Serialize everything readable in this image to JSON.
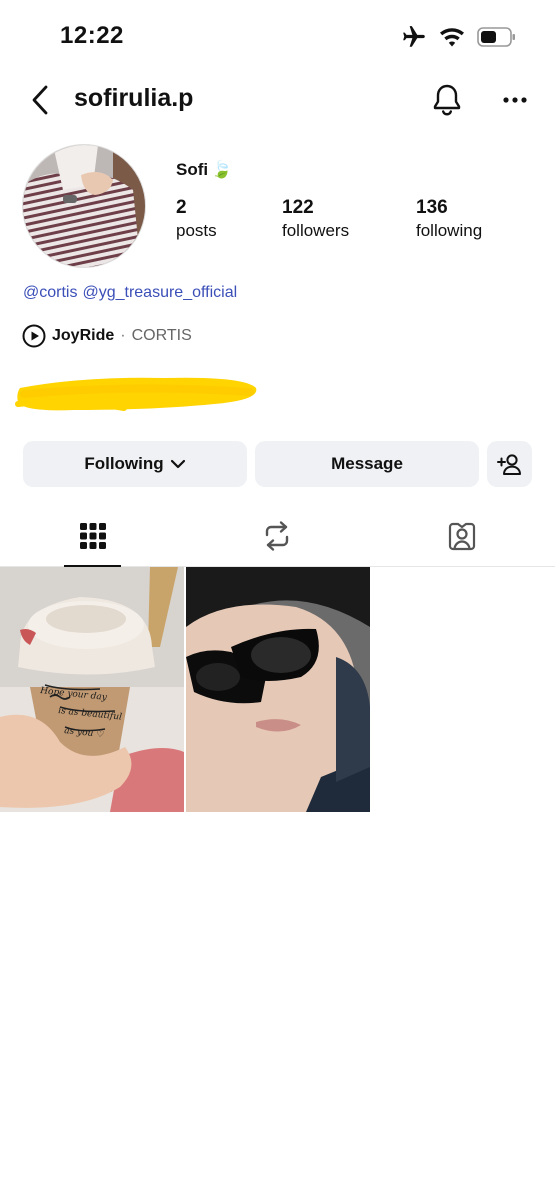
{
  "status_bar": {
    "time": "12:22"
  },
  "header": {
    "username": "sofirulia.p"
  },
  "profile": {
    "display_name": "Sofi",
    "name_emoji": "🍃",
    "stats": [
      {
        "value": "2",
        "label": "posts"
      },
      {
        "value": "122",
        "label": "followers"
      },
      {
        "value": "136",
        "label": "following"
      }
    ],
    "mentions": [
      "@cortis",
      "@yg_treasure_official"
    ],
    "music": {
      "song": "JoyRide",
      "separator": "·",
      "artist": "CORTIS"
    }
  },
  "actions": {
    "following_label": "Following",
    "message_label": "Message"
  },
  "posts": [
    {
      "handwriting": [
        "Hope your day",
        "is as beautiful",
        "as you ♡"
      ]
    },
    {}
  ],
  "colors": {
    "link": "#3b4fb8",
    "button_bg": "#eff1f4",
    "redaction": "#ffd400"
  }
}
